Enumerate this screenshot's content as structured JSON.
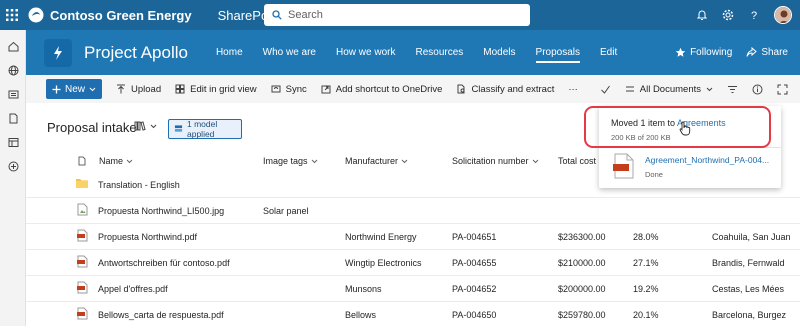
{
  "suite": {
    "brand_name": "Contoso Green Energy",
    "app_name": "SharePoint",
    "search_placeholder": "Search"
  },
  "site": {
    "title": "Project Apollo",
    "nav": [
      "Home",
      "Who we are",
      "How we work",
      "Resources",
      "Models",
      "Proposals",
      "Edit"
    ],
    "active_nav": "Proposals",
    "following_label": "Following",
    "share_label": "Share"
  },
  "commands": {
    "new_label": "New",
    "upload_label": "Upload",
    "grid_label": "Edit in grid view",
    "sync_label": "Sync",
    "shortcut_label": "Add shortcut to OneDrive",
    "classify_label": "Classify and extract",
    "more_label": "···",
    "view_label": "All Documents"
  },
  "library": {
    "title": "Proposal intake",
    "model_badge": "1 model applied"
  },
  "table": {
    "headers": {
      "name": "Name",
      "image_tags": "Image tags",
      "manufacturer": "Manufacturer",
      "solicitation": "Solicitation number",
      "total_cost": "Total cost"
    },
    "rows": [
      {
        "type": "folder",
        "name": "Translation - English",
        "image_tags": "",
        "manufacturer": "",
        "solicitation": "",
        "cost": "",
        "percent": "",
        "location": ""
      },
      {
        "type": "image",
        "name": "Propuesta Northwind_LI500.jpg",
        "image_tags": "Solar panel",
        "manufacturer": "",
        "solicitation": "",
        "cost": "",
        "percent": "",
        "location": ""
      },
      {
        "type": "pdf",
        "name": "Propuesta Northwind.pdf",
        "image_tags": "",
        "manufacturer": "Northwind Energy",
        "solicitation": "PA-004651",
        "cost": "$236300.00",
        "percent": "28.0%",
        "location": "Coahuila, San Juan"
      },
      {
        "type": "pdf",
        "name": "Antwortschreiben für contoso.pdf",
        "image_tags": "",
        "manufacturer": "Wingtip Electronics",
        "solicitation": "PA-004655",
        "cost": "$210000.00",
        "percent": "27.1%",
        "location": "Brandis, Fernwald"
      },
      {
        "type": "pdf",
        "name": "Appel d'offres.pdf",
        "image_tags": "",
        "manufacturer": "Munsons",
        "solicitation": "PA-004652",
        "cost": "$200000.00",
        "percent": "19.2%",
        "location": "Cestas, Les Mées"
      },
      {
        "type": "pdf",
        "name": "Bellows_carta de respuesta.pdf",
        "image_tags": "",
        "manufacturer": "Bellows",
        "solicitation": "PA-004650",
        "cost": "$259780.00",
        "percent": "20.1%",
        "location": "Barcelona, Burgez"
      }
    ]
  },
  "toast": {
    "title_prefix": "Moved 1 item to ",
    "link_text": "Agreements",
    "size_text": "200 KB of 200 KB",
    "file_name": "Agreement_Northwind_PA-004...",
    "status": "Done"
  },
  "colors": {
    "suite_bar": "#1b6599",
    "site_header": "#1f77b4",
    "accent": "#1f6fb0",
    "highlight": "#e63946"
  }
}
